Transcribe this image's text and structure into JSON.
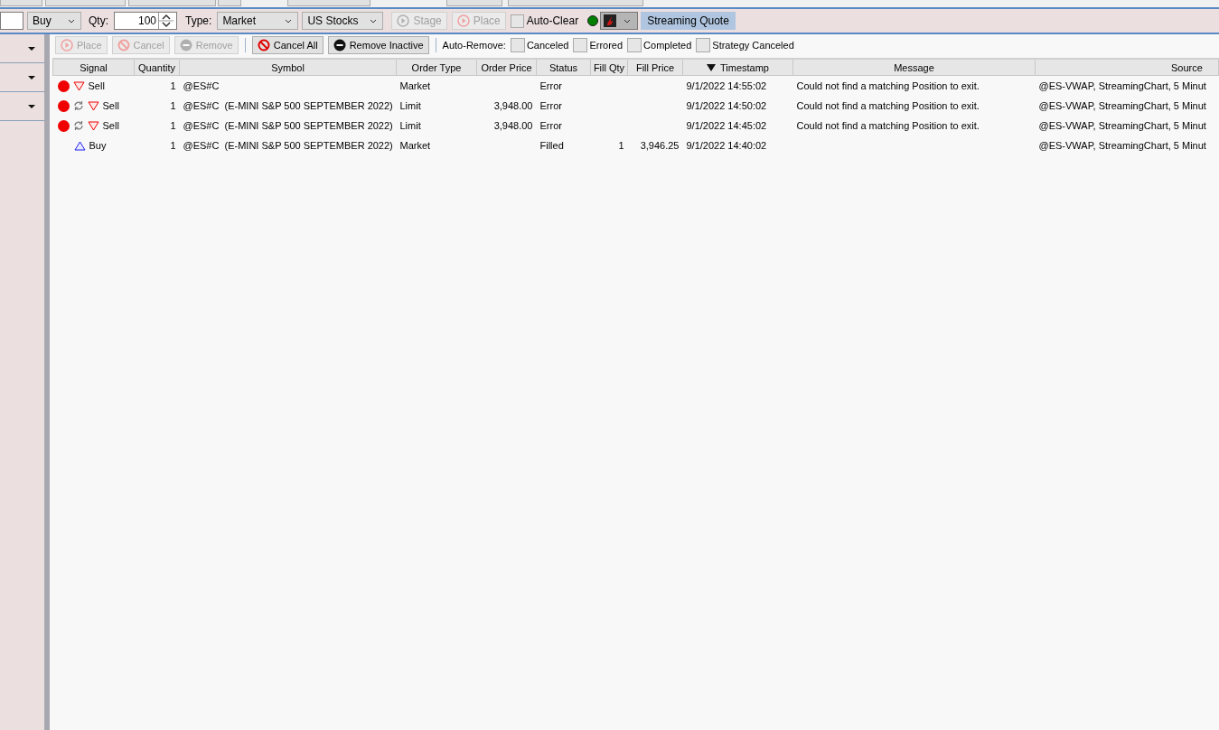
{
  "order_bar": {
    "side": "Buy",
    "qty_label": "Qty:",
    "qty": "100",
    "type_label": "Type:",
    "order_type": "Market",
    "market": "US Stocks",
    "buttons": [
      {
        "label": "Stage",
        "kind": "stage",
        "disabled": true
      },
      {
        "label": "Place",
        "kind": "place",
        "disabled": true
      }
    ],
    "auto_clear": {
      "label": "Auto-Clear",
      "checked": false
    },
    "connected": true,
    "streaming_quote": {
      "label": "Streaming Quote",
      "selected": true
    }
  },
  "toolbar": {
    "buttons": [
      {
        "label": "Place",
        "kind": "place",
        "disabled": true
      },
      {
        "label": "Cancel",
        "kind": "cancel",
        "disabled": true
      },
      {
        "label": "Remove",
        "kind": "remove",
        "disabled": true
      },
      {
        "label": "Cancel All",
        "kind": "cancel",
        "disabled": false
      },
      {
        "label": "Remove Inactive",
        "kind": "remove",
        "disabled": false
      }
    ],
    "auto_remove_label": "Auto-Remove:",
    "auto_remove": [
      {
        "label": "Canceled",
        "checked": false
      },
      {
        "label": "Errored",
        "checked": false
      },
      {
        "label": "Completed",
        "checked": false
      },
      {
        "label": "Strategy Canceled",
        "checked": false
      }
    ]
  },
  "table": {
    "columns": [
      {
        "label": "Signal",
        "sorted": false
      },
      {
        "label": "Quantity",
        "sorted": false
      },
      {
        "label": "Symbol",
        "sorted": false
      },
      {
        "label": "Order Type",
        "sorted": false
      },
      {
        "label": "Order Price",
        "sorted": false
      },
      {
        "label": "Status",
        "sorted": false
      },
      {
        "label": "Fill Qty",
        "sorted": false
      },
      {
        "label": "Fill Price",
        "sorted": false
      },
      {
        "label": "Timestamp",
        "sorted": true
      },
      {
        "label": "Message",
        "sorted": false
      },
      {
        "label": "Source",
        "sorted": false
      }
    ],
    "rows": [
      {
        "signal": {
          "kind": "sell",
          "error": true,
          "recurring": false
        },
        "cells": [
          "Sell",
          "1",
          "@ES#C",
          "Market",
          "",
          "Error",
          "",
          "",
          "9/1/2022 14:55:02",
          "Could not find a matching Position to exit.",
          "@ES-VWAP, StreamingChart, 5 Minut"
        ]
      },
      {
        "signal": {
          "kind": "sell",
          "error": true,
          "recurring": true
        },
        "cells": [
          "Sell",
          "1",
          "@ES#C  (E-MINI S&P 500 SEPTEMBER 2022)",
          "Limit",
          "3,948.00",
          "Error",
          "",
          "",
          "9/1/2022 14:50:02",
          "Could not find a matching Position to exit.",
          "@ES-VWAP, StreamingChart, 5 Minut"
        ]
      },
      {
        "signal": {
          "kind": "sell",
          "error": true,
          "recurring": true
        },
        "cells": [
          "Sell",
          "1",
          "@ES#C  (E-MINI S&P 500 SEPTEMBER 2022)",
          "Limit",
          "3,948.00",
          "Error",
          "",
          "",
          "9/1/2022 14:45:02",
          "Could not find a matching Position to exit.",
          "@ES-VWAP, StreamingChart, 5 Minut"
        ]
      },
      {
        "signal": {
          "kind": "buy",
          "error": false,
          "recurring": false
        },
        "cells": [
          "Buy",
          "1",
          "@ES#C  (E-MINI S&P 500 SEPTEMBER 2022)",
          "Market",
          "",
          "Filled",
          "1",
          "3,946.25",
          "9/1/2022 14:40:02",
          "",
          "@ES-VWAP, StreamingChart, 5 Minut"
        ]
      }
    ]
  }
}
